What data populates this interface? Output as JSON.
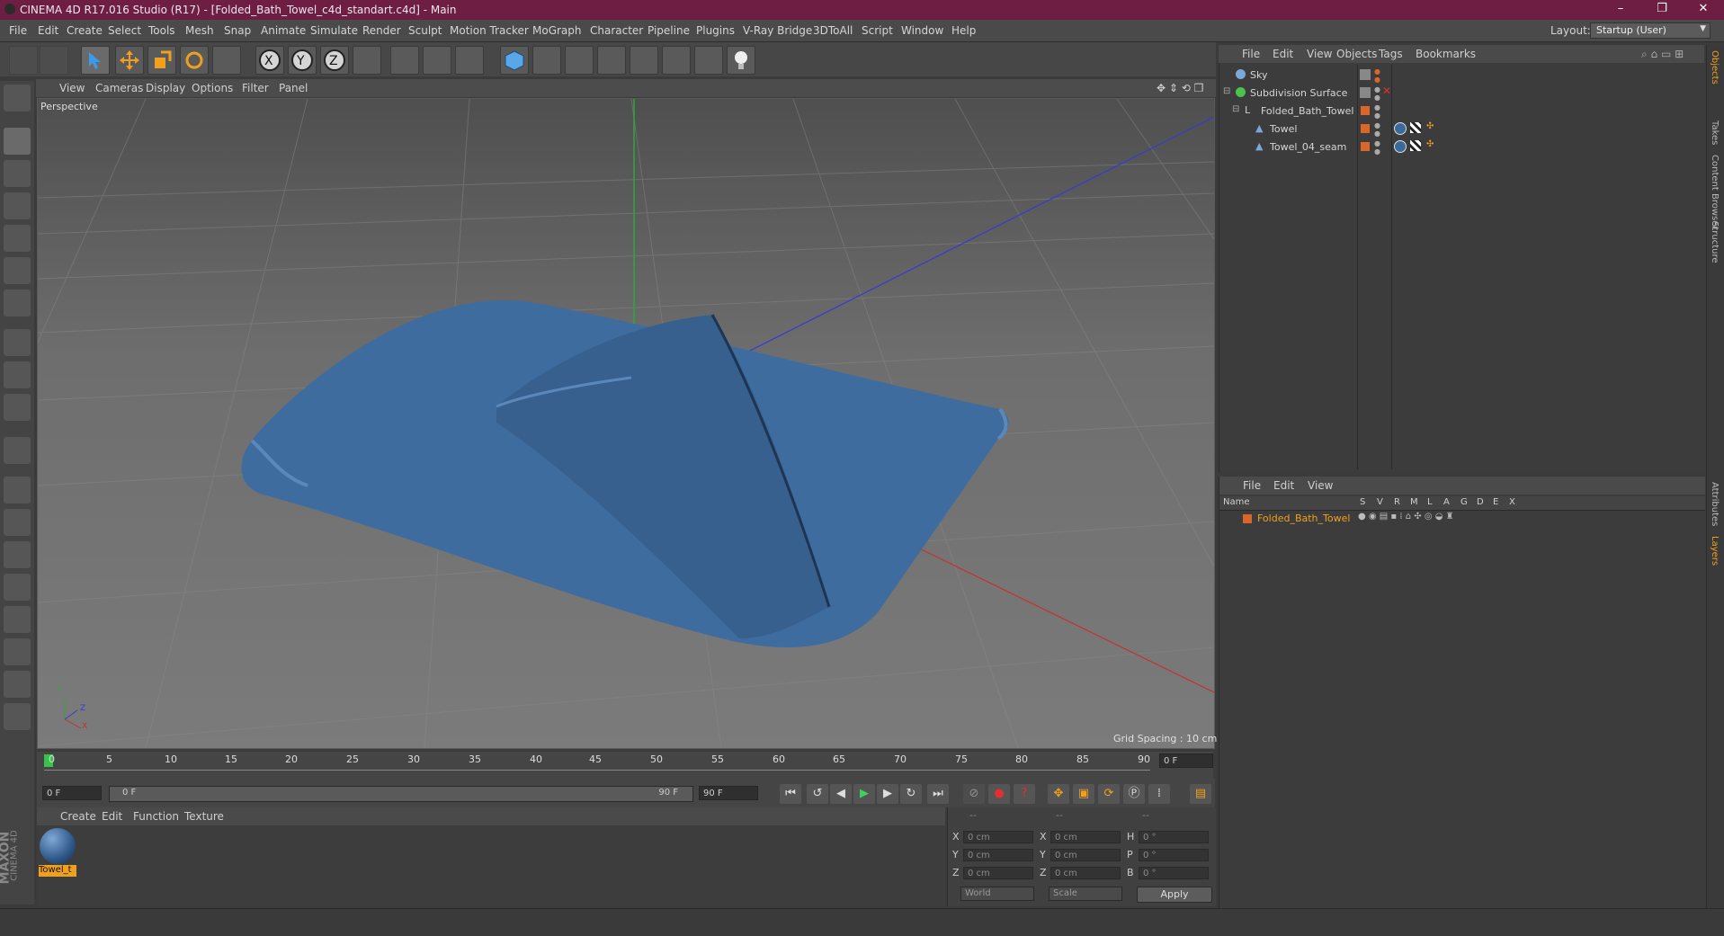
{
  "window": {
    "title": "CINEMA 4D R17.016 Studio (R17) - [Folded_Bath_Towel_c4d_standart.c4d] - Main",
    "minimize": "–",
    "maximize": "❐",
    "close": "✕"
  },
  "menu": [
    "File",
    "Edit",
    "Create",
    "Select",
    "Tools",
    "Mesh",
    "Snap",
    "Animate",
    "Simulate",
    "Render",
    "Sculpt",
    "Motion Tracker",
    "MoGraph",
    "Character",
    "Pipeline",
    "Plugins",
    "V-Ray Bridge",
    "3DToAll",
    "Script",
    "Window",
    "Help"
  ],
  "layout": {
    "label": "Layout:",
    "value": "Startup (User)"
  },
  "viewport": {
    "menu": [
      "View",
      "Cameras",
      "Display",
      "Options",
      "Filter",
      "Panel"
    ],
    "name": "Perspective",
    "grid_spacing": "Grid Spacing : 10 cm",
    "axis_x": "X",
    "axis_y": "Y",
    "axis_z": "Z"
  },
  "timeline": {
    "ticks": [
      "0",
      "5",
      "10",
      "15",
      "20",
      "25",
      "30",
      "35",
      "40",
      "45",
      "50",
      "55",
      "60",
      "65",
      "70",
      "75",
      "80",
      "85",
      "90"
    ],
    "current_frame": "0 F",
    "start_field": "0 F",
    "range_start": "0 F",
    "range_end": "90 F",
    "end_field": "90 F"
  },
  "material_manager": {
    "menu": [
      "Create",
      "Edit",
      "Function",
      "Texture"
    ],
    "materials": [
      {
        "name": "Towel_t"
      }
    ]
  },
  "coordinates": {
    "headers": [
      "--",
      "--",
      "--"
    ],
    "rows": [
      {
        "l1": "X",
        "v1": "0 cm",
        "l2": "X",
        "v2": "0 cm",
        "l3": "H",
        "v3": "0 °"
      },
      {
        "l1": "Y",
        "v1": "0 cm",
        "l2": "Y",
        "v2": "0 cm",
        "l3": "P",
        "v3": "0 °"
      },
      {
        "l1": "Z",
        "v1": "0 cm",
        "l2": "Z",
        "v2": "0 cm",
        "l3": "B",
        "v3": "0 °"
      }
    ],
    "mode": "World",
    "scale_mode": "Scale",
    "apply": "Apply"
  },
  "object_manager": {
    "menu": [
      "File",
      "Edit",
      "View",
      "Objects",
      "Tags",
      "Bookmarks"
    ],
    "objects": [
      {
        "name": "Sky"
      },
      {
        "name": "Subdivision Surface"
      },
      {
        "name": "Folded_Bath_Towel"
      },
      {
        "name": "Towel"
      },
      {
        "name": "Towel_04_seam"
      }
    ]
  },
  "layer_manager": {
    "menu": [
      "File",
      "Edit",
      "View"
    ],
    "name_col": "Name",
    "flags": [
      "S",
      "V",
      "R",
      "M",
      "L",
      "A",
      "G",
      "D",
      "E",
      "X"
    ],
    "layers": [
      {
        "name": "Folded_Bath_Towel"
      }
    ]
  },
  "side_tabs": [
    "Objects",
    "Takes",
    "Content Browser",
    "Structure",
    "Attributes",
    "Layers"
  ],
  "brand": {
    "maxon": "MAXON",
    "cinema": "CINEMA 4D"
  },
  "colors": {
    "titlebar": "#6d1e42",
    "towel": "#3f6c9f",
    "layer_orange": "#d9672a"
  }
}
